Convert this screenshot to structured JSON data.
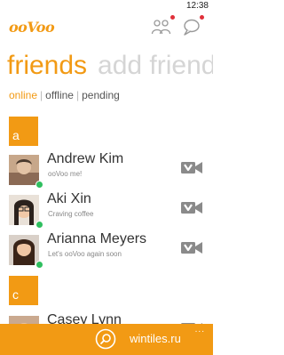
{
  "status_bar": {
    "time": "12:38"
  },
  "app": {
    "logo": "ooVoo"
  },
  "pivot": {
    "active": "friends",
    "next": "add friends"
  },
  "subtabs": [
    "online",
    "offline",
    "pending"
  ],
  "groups": [
    "a",
    "c"
  ],
  "contacts": [
    {
      "name": "Andrew Kim",
      "status": "ooVoo me!"
    },
    {
      "name": "Aki Xin",
      "status": "Craving coffee"
    },
    {
      "name": "Arianna Meyers",
      "status": "Let's ooVoo again soon"
    },
    {
      "name": "Casey Lynn",
      "status": ""
    }
  ],
  "app_bar": {
    "watermark": "wintiles.ru",
    "more": "..."
  },
  "colors": {
    "accent": "#f29a14",
    "presence": "#2fbf5f",
    "notification": "#e0303a"
  },
  "icons": {
    "people": "people-icon",
    "chat": "chat-icon",
    "video": "video-camera-icon",
    "search": "search-icon"
  }
}
